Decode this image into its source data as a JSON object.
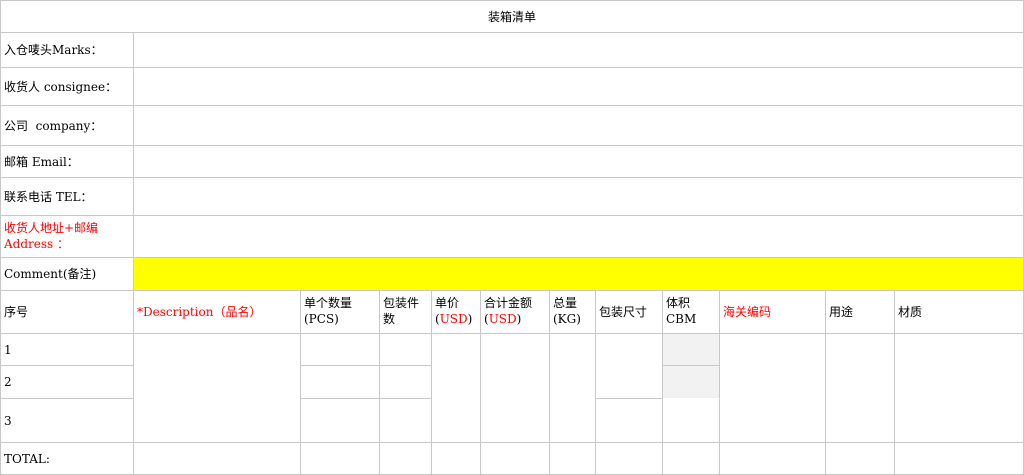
{
  "title": "装箱清单",
  "info_rows": [
    {
      "label": "入仓唛头Marks："
    },
    {
      "label": "收货人 consignee："
    },
    {
      "label": "公司  company："
    },
    {
      "label": "邮箱 Email："
    },
    {
      "label": "联系电话 TEL："
    },
    {
      "label_line1": "收货人地址+邮编",
      "label_line2": "Address ："
    },
    {
      "label": "Comment(备注)"
    }
  ],
  "headers": {
    "no": "序号",
    "description": "*Description（品名）",
    "qty_line1": "单个数量",
    "qty_line2": "(PCS)",
    "packages_line1": "包装件",
    "packages_line2": "数",
    "price_line1": "单价",
    "price_line2_open": "(",
    "price_line2_cur": "USD",
    "price_line2_close": ")",
    "amount_line1": "合计金额",
    "amount_line2_open": "(",
    "amount_line2_cur": "USD",
    "amount_line2_close": ")",
    "weight_line1": "总量",
    "weight_line2": "(KG)",
    "dims": "包装尺寸",
    "volume_line1": "体积",
    "volume_line2": "CBM",
    "hs_code": "海关编码",
    "usage": "用途",
    "material": "材质"
  },
  "rows": [
    {
      "no": "1"
    },
    {
      "no": "2"
    },
    {
      "no": "3"
    }
  ],
  "total_label": "TOTAL:",
  "colors": {
    "highlight": "#ffff00",
    "required_text": "#ff0000",
    "grid": "#c8c8c8"
  }
}
